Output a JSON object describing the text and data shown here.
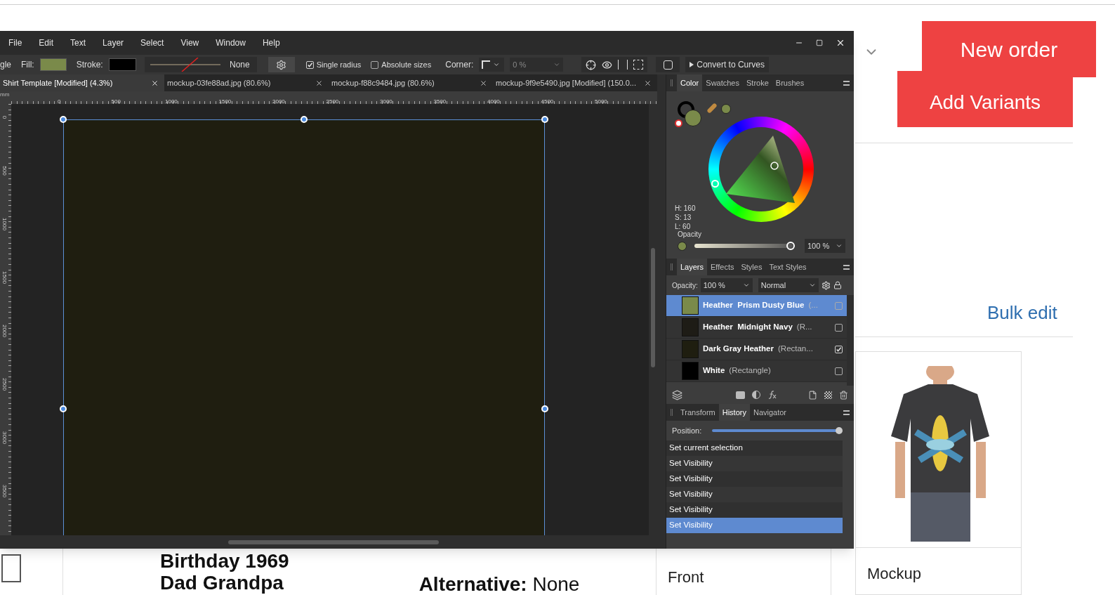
{
  "web_page": {
    "new_order_button": "New order",
    "add_variants_button": "Add Variants",
    "bulk_edit_link": "Bulk edit",
    "design_title": "Birthday 1969",
    "design_subtitle": "Dad Grandpa",
    "alternative": "**Alternative:** None",
    "front_card": "Front",
    "mockup_card": "Mockup"
  },
  "app": {
    "menu": [
      "File",
      "Edit",
      "Text",
      "Layer",
      "Select",
      "View",
      "Window",
      "Help"
    ],
    "toolbar": {
      "tool_label": "gle",
      "fill_label": "Fill:",
      "stroke_label": "Stroke:",
      "stroke_style": "None",
      "single_radius": {
        "label": "Single radius",
        "checked": true
      },
      "absolute_sizes": {
        "label": "Absolute sizes",
        "checked": false
      },
      "corner_label": "Corner:",
      "corner_value": "0 %",
      "convert_button": "Convert to Curves"
    },
    "document_tabs": [
      {
        "label": "Shirt Template [Modified] (4.3%)",
        "selected": true
      },
      {
        "label": "mockup-03fe88ad.jpg (80.6%)",
        "selected": false
      },
      {
        "label": "mockup-f88c9484.jpg (80.6%)",
        "selected": false
      },
      {
        "label": "mockup-9f9e5490.jpg [Modified] (150.0...",
        "selected": false
      }
    ],
    "ruler": {
      "unit": "mm",
      "x_labels": [
        "0",
        "500",
        "1000",
        "1500",
        "2000",
        "2500",
        "3000",
        "3500",
        "4000",
        "4500",
        "5000"
      ],
      "y_labels": [
        "0",
        "500",
        "1000",
        "1500",
        "2000",
        "2500",
        "3000",
        "3500"
      ]
    },
    "color_panel": {
      "tabs": [
        {
          "label": "Color",
          "selected": true
        },
        {
          "label": "Swatches",
          "selected": false
        },
        {
          "label": "Stroke",
          "selected": false
        },
        {
          "label": "Brushes",
          "selected": false
        }
      ],
      "hsl": [
        "H: 160",
        "S: 13",
        "L: 60"
      ],
      "opacity_label": "Opacity",
      "opacity": {
        "level": 1
      },
      "opacity_value": "100 %"
    },
    "layers_panel": {
      "tabs": [
        {
          "label": "Layers",
          "selected": true
        },
        {
          "label": "Effects",
          "selected": false
        },
        {
          "label": "Styles",
          "selected": false
        },
        {
          "label": "Text Styles",
          "selected": false
        }
      ],
      "opacity_label": "Opacity:",
      "opacity_value": "100 %",
      "blend_mode": "Normal",
      "layers": [
        {
          "name": "Heather  Prism Dusty Blue",
          "type": "(...",
          "color": "#7a8a4a",
          "selected": true,
          "visible": false
        },
        {
          "name": "Heather  Midnight Navy",
          "type": "(R...",
          "color": "#1e1c16",
          "selected": false,
          "visible": false
        },
        {
          "name": "Dark Gray Heather",
          "type": "(Rectan...",
          "color": "#1f1e10",
          "selected": false,
          "visible": true
        },
        {
          "name": "White",
          "type": "(Rectangle)",
          "color": "#000000",
          "selected": false,
          "visible": false
        }
      ]
    },
    "history_panel": {
      "tabs": [
        {
          "label": "Transform",
          "selected": false
        },
        {
          "label": "History",
          "selected": true
        },
        {
          "label": "Navigator",
          "selected": false
        }
      ],
      "position_label": "Position:",
      "position": {
        "level": 1
      },
      "items": [
        {
          "label": "Set current selection",
          "selected": false
        },
        {
          "label": "Set Visibility",
          "selected": false
        },
        {
          "label": "Set Visibility",
          "selected": false
        },
        {
          "label": "Set Visibility",
          "selected": false
        },
        {
          "label": "Set Visibility",
          "selected": false
        },
        {
          "label": "Set Visibility",
          "selected": true
        }
      ]
    }
  }
}
